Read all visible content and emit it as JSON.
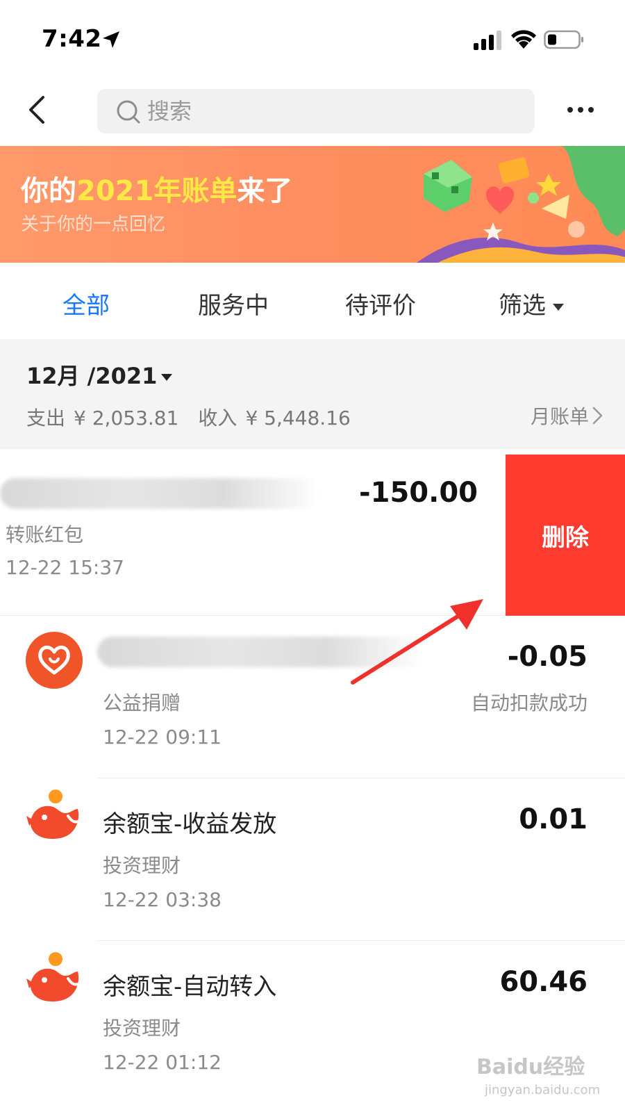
{
  "status_bar": {
    "time": "7:42"
  },
  "nav": {
    "search_placeholder": "搜索"
  },
  "banner": {
    "title_prefix": "你的",
    "title_highlight": "2021年账单",
    "title_suffix": "来了",
    "subtitle": "关于你的一点回忆"
  },
  "tabs": [
    {
      "label": "全部",
      "active": true
    },
    {
      "label": "服务中",
      "active": false
    },
    {
      "label": "待评价",
      "active": false
    },
    {
      "label": "筛选",
      "active": false
    }
  ],
  "month": {
    "label": "12月 /2021",
    "expense_label": "支出",
    "expense_value": "¥ 2,053.81",
    "income_label": "收入",
    "income_value": "¥ 5,448.16",
    "monthly_bill": "月账单"
  },
  "transactions": [
    {
      "amount": "-150.00",
      "category": "转账红包",
      "time": "12-22  15:37",
      "swiped": true,
      "delete_label": "删除"
    },
    {
      "amount": "-0.05",
      "category": "公益捐赠",
      "status": "自动扣款成功",
      "time": "12-22  09:11",
      "icon": "charity-heart-icon"
    },
    {
      "title": "余额宝-收益发放",
      "amount": "0.01",
      "category": "投资理财",
      "time": "12-22  03:38",
      "icon": "yuebao-icon"
    },
    {
      "title": "余额宝-自动转入",
      "amount": "60.46",
      "category": "投资理财",
      "time": "12-22  01:12",
      "icon": "yuebao-icon"
    }
  ],
  "watermark": {
    "text": "Baidu经验",
    "sub": "jingyan.baidu.com"
  },
  "colors": {
    "accent": "#1677ff",
    "delete": "#ff3b30",
    "banner": "#ff9062",
    "highlight": "#ffe845"
  }
}
